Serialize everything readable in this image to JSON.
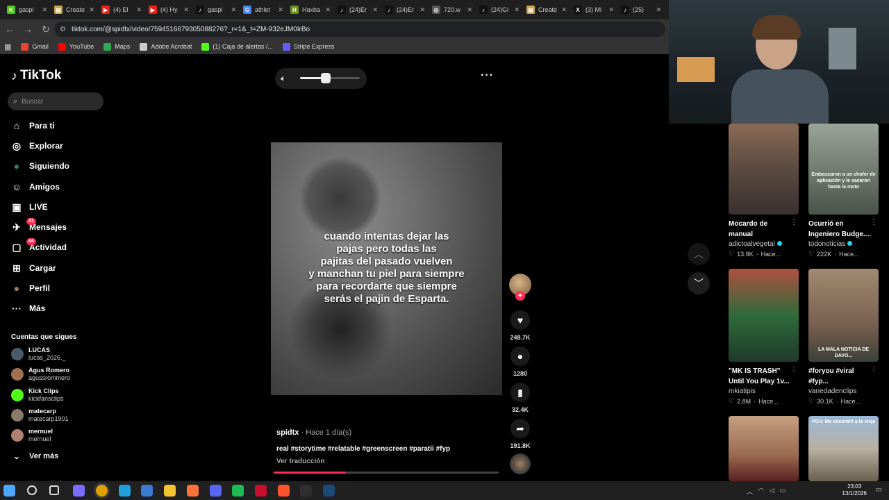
{
  "browser": {
    "tabs": [
      {
        "label": "gaspi",
        "color": "#52c41a",
        "glyph": "K"
      },
      {
        "label": "Create",
        "color": "#c9a44a",
        "glyph": "▤"
      },
      {
        "label": "(4) El",
        "color": "#e62117",
        "glyph": "▶"
      },
      {
        "label": "(4) Hy",
        "color": "#e62117",
        "glyph": "▶"
      },
      {
        "label": "gaspi",
        "color": "#111111",
        "glyph": "♪"
      },
      {
        "label": "athlet",
        "color": "#4285f4",
        "glyph": "G"
      },
      {
        "label": "Haxba",
        "color": "#6b8e23",
        "glyph": "H"
      },
      {
        "label": "(24)Er",
        "color": "#111111",
        "glyph": "♪"
      },
      {
        "label": "(24)Er",
        "color": "#111111",
        "glyph": "♪"
      },
      {
        "label": "720.w",
        "color": "#555555",
        "glyph": "◎"
      },
      {
        "label": "(24)Gi",
        "color": "#111111",
        "glyph": "♪"
      },
      {
        "label": "Create",
        "color": "#c9a44a",
        "glyph": "▤"
      },
      {
        "label": "(3) Mi",
        "color": "#111111",
        "glyph": "X"
      },
      {
        "label": "(25)",
        "color": "#111111",
        "glyph": "♪"
      }
    ],
    "url": "tiktok.com/@spidtx/video/7594516679305088276?_r=1&_t=ZM-932eJM0IrBo",
    "bookmarks": [
      {
        "label": "Gmail",
        "color": "#ea4335"
      },
      {
        "label": "YouTube",
        "color": "#ff0000"
      },
      {
        "label": "Maps",
        "color": "#34a853"
      },
      {
        "label": "Adobe Acrobat",
        "color": "#cccccc"
      },
      {
        "label": "(1) Caja de alertas /...",
        "color": "#53fc18"
      },
      {
        "label": "Stripe Express",
        "color": "#635bff"
      }
    ]
  },
  "tiktok": {
    "logo": "TikTok",
    "search_placeholder": "Buscar",
    "nav": [
      {
        "label": "Para ti",
        "icon": "home-icon",
        "glyph": "⌂",
        "badge": ""
      },
      {
        "label": "Explorar",
        "icon": "compass-icon",
        "glyph": "◎",
        "badge": ""
      },
      {
        "label": "Siguiendo",
        "icon": "following-icon",
        "glyph": "●",
        "badge": ""
      },
      {
        "label": "Amigos",
        "icon": "friends-icon",
        "glyph": "☺",
        "badge": ""
      },
      {
        "label": "LIVE",
        "icon": "live-icon",
        "glyph": "▣",
        "badge": ""
      },
      {
        "label": "Mensajes",
        "icon": "messages-icon",
        "glyph": "✈",
        "badge": "31"
      },
      {
        "label": "Actividad",
        "icon": "activity-icon",
        "glyph": "▢",
        "badge": "44"
      },
      {
        "label": "Cargar",
        "icon": "upload-icon",
        "glyph": "⊞",
        "badge": ""
      },
      {
        "label": "Perfil",
        "icon": "profile-icon",
        "glyph": "●",
        "badge": ""
      },
      {
        "label": "Más",
        "icon": "more-icon",
        "glyph": "···",
        "badge": ""
      }
    ],
    "following_title": "Cuentas que sigues",
    "following": [
      {
        "name": "LUCAS",
        "user": "lucas_2026._",
        "color": "#4a5a6a"
      },
      {
        "name": "Agus Romero",
        "user": "agussrommero",
        "color": "#a07050"
      },
      {
        "name": "Kick Clips",
        "user": "kickfansclips",
        "color": "#53fc18"
      },
      {
        "name": "matecarp",
        "user": "matecarp1901",
        "color": "#8a7a6a"
      },
      {
        "name": "mernuel",
        "user": "mernuel",
        "color": "#b08070"
      }
    ],
    "see_more": "Ver más"
  },
  "video": {
    "caption": "cuando intentas dejar las\npajas pero todas las\npajitas del pasado vuelven\ny manchan tu piel para siempre\npara recordarte que siempre\nserás el pajin de Esparta.",
    "author": "spidtx",
    "posted": "· Hace 1 día(s)",
    "description": "real #storytime #relatable #greenscreen #paratii #fyp",
    "translate": "Ver traducción",
    "likes": "248.7K",
    "comments": "1280",
    "saves": "32.4K",
    "shares": "191.8K",
    "volume_level": 0.43,
    "progress": 0.32
  },
  "recommendations": [
    {
      "title": "Mocardo de manual",
      "author": "adictoalvegetal",
      "verified": true,
      "likes": "13.9K",
      "time": "Hace...",
      "overlay": "",
      "bg": "linear-gradient(180deg,#8a6a55 0%,#5a4a40 50%,#3a3030 100%)"
    },
    {
      "title": "Ocurrió en Ingeniero Budge....",
      "author": "todonoticias",
      "verified": true,
      "likes": "222K",
      "time": "Hace...",
      "overlay": "Emboscaron a un chofer de aplicación y le sacaron hasta la moto",
      "bg": "linear-gradient(180deg,#9aa49a 0%,#6a7468 60%,#4a524a 100%)"
    },
    {
      "title": "\"MK IS TRASH\" Until You Play 1v...",
      "author": "mkiatipis",
      "verified": false,
      "likes": "2.8M",
      "time": "Hace...",
      "overlay": "",
      "bg": "linear-gradient(180deg,#b05040 0%,#2f6a3a 50%,#1f3a2a 100%)"
    },
    {
      "title": "#foryou #viral #fyp...",
      "author": "variedadenclips",
      "verified": false,
      "likes": "30.1K",
      "time": "Hace...",
      "overlay": "LA MALA NOTICIA DE DAVO...",
      "bg": "linear-gradient(180deg,#a08a70 0%,#7a6050 60%,#3a4038 100%)"
    },
    {
      "title": "",
      "author": "",
      "verified": false,
      "likes": "",
      "time": "",
      "overlay": "",
      "bg": "linear-gradient(180deg,#c4a080 0%,#9a6a50 60%,#5a2020 100%)"
    },
    {
      "title": "",
      "author": "",
      "verified": false,
      "likes": "",
      "time": "",
      "overlay": "POV: Me encontré a la vieja",
      "bg": "linear-gradient(180deg,#9ab8d8 0%,#b8b0a0 50%,#6a6050 100%)"
    }
  ],
  "taskbar": {
    "time": "23:03",
    "date": "13/1/2026",
    "apps": [
      {
        "name": "windows-icon",
        "color": "#4ba8ff"
      },
      {
        "name": "search-icon",
        "color": "#202020"
      },
      {
        "name": "task-view-icon",
        "color": "#202020"
      },
      {
        "name": "copilot-icon",
        "color": "#7a6cff"
      },
      {
        "name": "chrome-icon",
        "color": "#e0a000"
      },
      {
        "name": "edge-icon",
        "color": "#1fa0d8"
      },
      {
        "name": "store-icon",
        "color": "#3a7bd5"
      },
      {
        "name": "explorer-icon",
        "color": "#f4c430"
      },
      {
        "name": "firefox-icon",
        "color": "#ff7139"
      },
      {
        "name": "discord-icon",
        "color": "#5865f2"
      },
      {
        "name": "spotify-icon",
        "color": "#1db954"
      },
      {
        "name": "app-red-icon",
        "color": "#c8102e"
      },
      {
        "name": "brave-icon",
        "color": "#fb542b"
      },
      {
        "name": "obs-icon",
        "color": "#302e31"
      },
      {
        "name": "steam-icon",
        "color": "#1b4a7a"
      }
    ]
  }
}
